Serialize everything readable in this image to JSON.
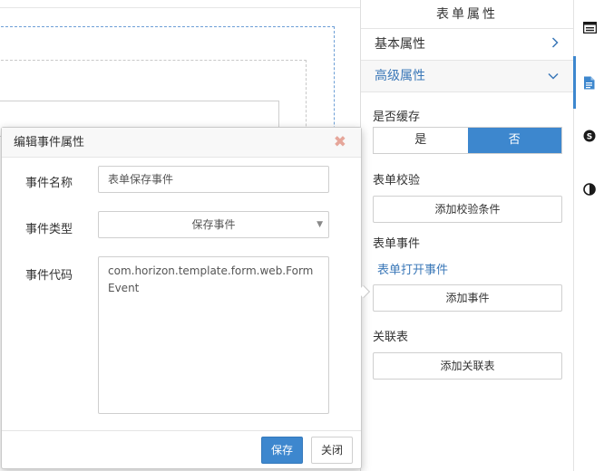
{
  "panel": {
    "title": "表单属性",
    "accordion": [
      {
        "label": "基本属性",
        "chevron": "chevron-right-icon"
      },
      {
        "label": "高级属性",
        "chevron": "chevron-down-icon"
      }
    ],
    "cache": {
      "label": "是否缓存",
      "options": [
        "是",
        "否"
      ],
      "selected": "否"
    },
    "validation": {
      "label": "表单校验",
      "button": "添加校验条件"
    },
    "events": {
      "label": "表单事件",
      "link": "表单打开事件",
      "button": "添加事件"
    },
    "related": {
      "label": "关联表",
      "button": "添加关联表"
    }
  },
  "rail": {
    "icons": [
      "window-icon",
      "document-icon",
      "skype-icon",
      "contrast-icon"
    ],
    "active": "document-icon"
  },
  "modal": {
    "title": "编辑事件属性",
    "fields": {
      "name": {
        "label": "事件名称",
        "value": "表单保存事件"
      },
      "type": {
        "label": "事件类型",
        "value": "保存事件"
      },
      "code": {
        "label": "事件代码",
        "value": "com.horizon.template.form.web.FormEvent"
      }
    },
    "buttons": {
      "save": "保存",
      "close": "关闭"
    }
  },
  "colors": {
    "accent": "#3d87ce",
    "link": "#3b78b8",
    "close_icon": "#e6a69a"
  }
}
